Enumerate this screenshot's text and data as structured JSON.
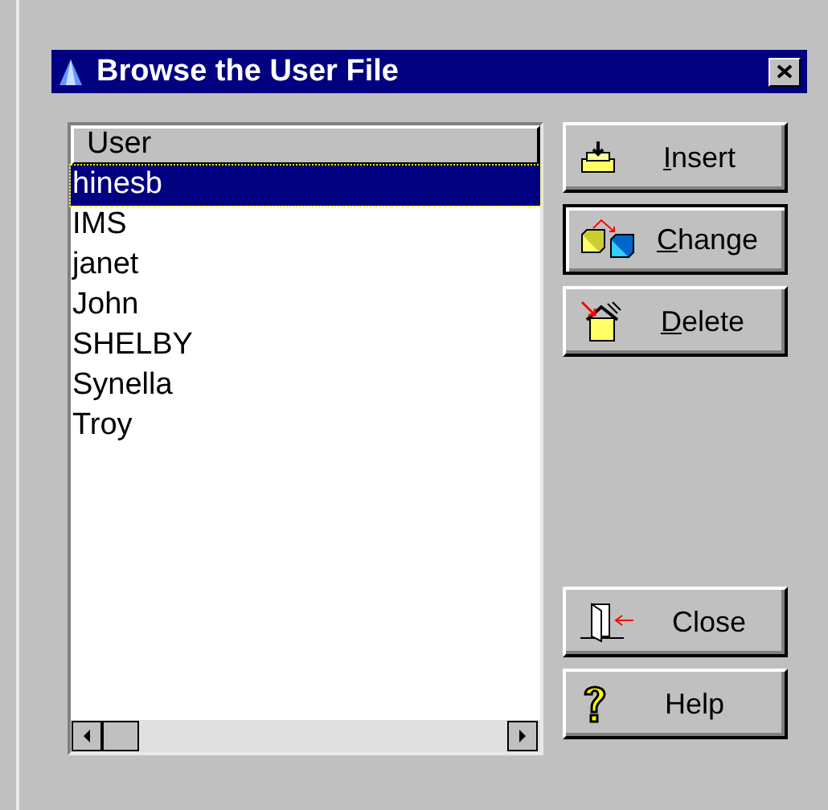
{
  "window": {
    "title": "Browse the User File"
  },
  "list": {
    "column": "User",
    "rows": [
      {
        "text": "hinesb",
        "selected": true
      },
      {
        "text": "IMS",
        "selected": false
      },
      {
        "text": "janet",
        "selected": false
      },
      {
        "text": "John",
        "selected": false
      },
      {
        "text": "SHELBY",
        "selected": false
      },
      {
        "text": "Synella",
        "selected": false
      },
      {
        "text": "Troy",
        "selected": false
      }
    ]
  },
  "buttons": [
    {
      "kind": "insert",
      "label": "Insert",
      "mnemonic": true,
      "focused": false
    },
    {
      "kind": "change",
      "label": "Change",
      "mnemonic": true,
      "focused": true
    },
    {
      "kind": "delete",
      "label": "Delete",
      "mnemonic": true,
      "focused": false
    },
    {
      "kind": "spacer"
    },
    {
      "kind": "close",
      "label": "Close",
      "mnemonic": false,
      "focused": false
    },
    {
      "kind": "help",
      "label": "Help",
      "mnemonic": false,
      "focused": false
    }
  ]
}
